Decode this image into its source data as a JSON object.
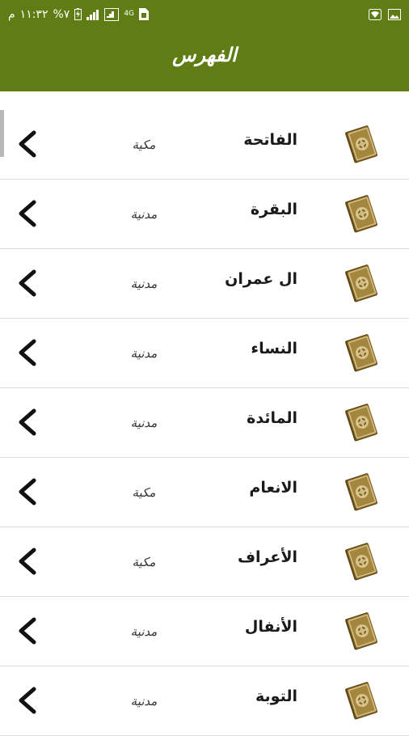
{
  "status_bar": {
    "period": "م",
    "time": "١١:٣٢",
    "battery": "%٧",
    "network": "4G"
  },
  "app_bar": {
    "title": "الفهرس"
  },
  "surahs": [
    {
      "name": "الفاتحة",
      "type": "مكية"
    },
    {
      "name": "البقرة",
      "type": "مدنية"
    },
    {
      "name": "ال عمران",
      "type": "مدنية"
    },
    {
      "name": "النساء",
      "type": "مدنية"
    },
    {
      "name": "المائدة",
      "type": "مدنية"
    },
    {
      "name": "الانعام",
      "type": "مكية"
    },
    {
      "name": "الأعراف",
      "type": "مكية"
    },
    {
      "name": "الأنفال",
      "type": "مدنية"
    },
    {
      "name": "التوبة",
      "type": "مدنية"
    }
  ],
  "icons": {
    "row_chevron": "chevron-left-icon",
    "row_book": "quran-book-icon"
  },
  "colors": {
    "primary": "#5f7d14",
    "book_cover": "#8a6d2b",
    "book_page": "#d9c08a"
  }
}
